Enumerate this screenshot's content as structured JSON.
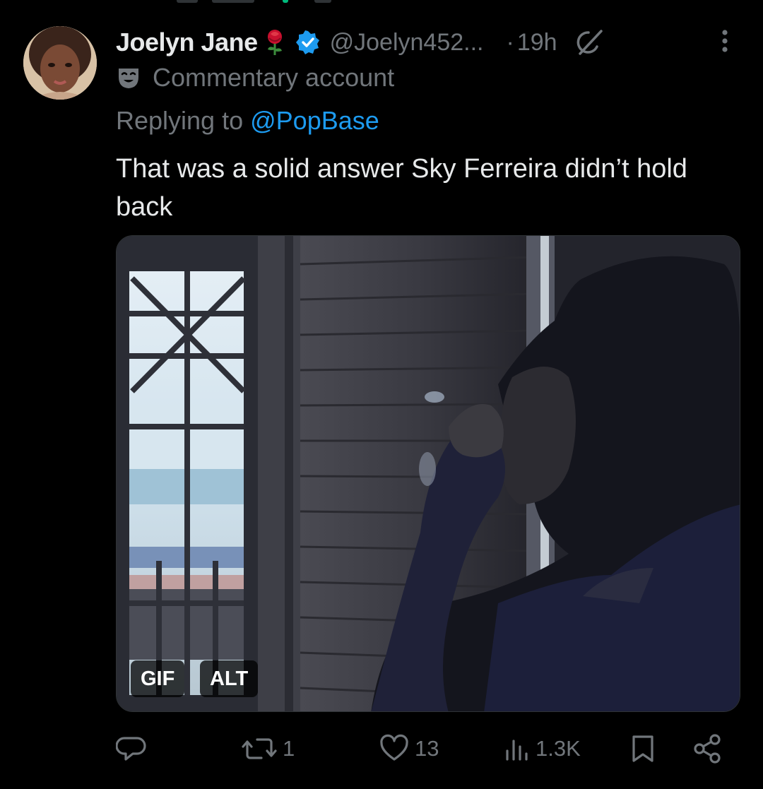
{
  "tweet": {
    "display_name": "Joelyn Jane",
    "handle": "@Joelyn452...",
    "separator": "·",
    "time": "19h",
    "label": "Commentary account",
    "replying_prefix": "Replying to",
    "replying_to": "@PopBase",
    "text": "That was a solid answer Sky Ferreira didn’t hold back",
    "media": {
      "badges": [
        "GIF",
        "ALT"
      ]
    },
    "metrics": {
      "reposts": "1",
      "likes": "13",
      "views": "1.3K"
    }
  },
  "icons": {
    "emoji_after_name": "rose-icon",
    "verified": "verified-badge-icon",
    "grok": "grok-icon",
    "more": "more-options-icon",
    "label_icon": "theater-mask-icon",
    "reply": "reply-icon",
    "repost": "repost-icon",
    "like": "heart-icon",
    "views": "views-icon",
    "bookmark": "bookmark-icon",
    "share": "share-icon"
  },
  "colors": {
    "background": "#000000",
    "primary_text": "#e7e9ea",
    "secondary_text": "#71767b",
    "link": "#1d9bf0",
    "verified": "#1d9bf0"
  }
}
